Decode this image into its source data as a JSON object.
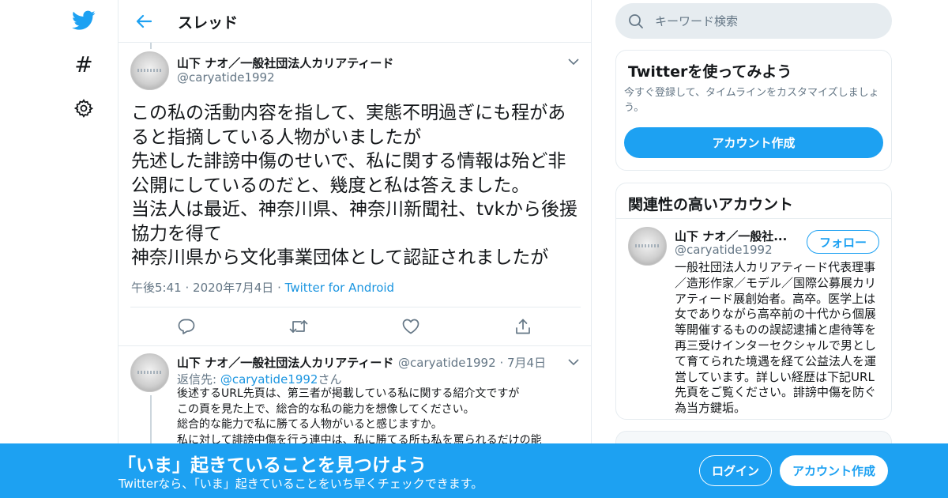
{
  "nav": {
    "logo_icon": "twitter-bird-icon",
    "items": [
      {
        "icon": "hashtag-icon",
        "glyph": "#"
      },
      {
        "icon": "gear-icon"
      }
    ]
  },
  "header": {
    "title": "スレッド",
    "back_icon": "arrow-left-icon"
  },
  "main_tweet": {
    "author_name": "山下 ナオ／一般社団法人カリアティード",
    "author_handle": "@caryatide1992",
    "text_lines": [
      "この私の活動内容を指して、実態不明過ぎにも程があ",
      "ると指摘している人物がいましたが",
      "先述した誹謗中傷のせいで、私に関する情報は殆ど非",
      "公開にしているのだと、幾度と私は答えました。",
      "当法人は最近、神奈川県、神奈川新聞社、tvkから後援",
      "協力を得て",
      "神奈川県から文化事業団体として認証されましたが"
    ],
    "time": "午後5:41",
    "date": "2020年7月4日",
    "separator": "·",
    "source": "Twitter for Android",
    "actions": [
      "reply-icon",
      "retweet-icon",
      "like-icon",
      "share-icon"
    ]
  },
  "reply_tweet": {
    "author_name": "山下 ナオ／一般社団法人カリアティード",
    "author_handle": "@caryatide1992",
    "separator": "·",
    "date": "7月4日",
    "reply_prefix": "返信先: ",
    "reply_mention": "@caryatide1992",
    "reply_suffix": "さん",
    "text_lines": [
      "後述するURL先頁は、第三者が掲載している私に関する紹介文ですが",
      "この頁を見た上で、総合的な私の能力を想像してください。",
      "総合的な能力で私に勝てる人物がいると感じますか。",
      "私に対して誹謗中傷を行う連中は、私に勝てる所も私を罵られるだけの能"
    ]
  },
  "search": {
    "placeholder": "キーワード検索"
  },
  "signup_card": {
    "title": "Twitterを使ってみよう",
    "subtitle_lines": [
      "今すぐ登録して、タイムラインをカスタマイズしましょ",
      "う。"
    ],
    "button": "アカウント作成"
  },
  "related_card": {
    "title": "関連性の高いアカウント",
    "name": "山下 ナオ／一般社...",
    "handle": "@caryatide1992",
    "follow_button": "フォロー",
    "bio_lines": [
      "一般社団法人カリアティード代表理事",
      "／造形作家／モデル／国際公募展カリ",
      "アティード展創始者。高卒。医学上は",
      "女でありながら高卒前の十代から個展",
      "等開催するものの誤認逮捕と虐待等を",
      "再三受けインターセクシャルで男とし",
      "て育てられた境遇を経て公益法人を運",
      "営しています。詳しい経歴は下記URL",
      "先頁をご覧ください。誹謗中傷を防ぐ",
      "為当方鍵垢。"
    ]
  },
  "banner": {
    "title": "「いま」起きていることを見つけよう",
    "subtitle": "Twitterなら、「いま」起きていることをいち早くチェックできます。",
    "login_button": "ログイン",
    "signup_button": "アカウント作成"
  },
  "colors": {
    "brand": "#1da1f2",
    "text": "#14171a",
    "secondary": "#657786",
    "border": "#e6ecf0"
  }
}
